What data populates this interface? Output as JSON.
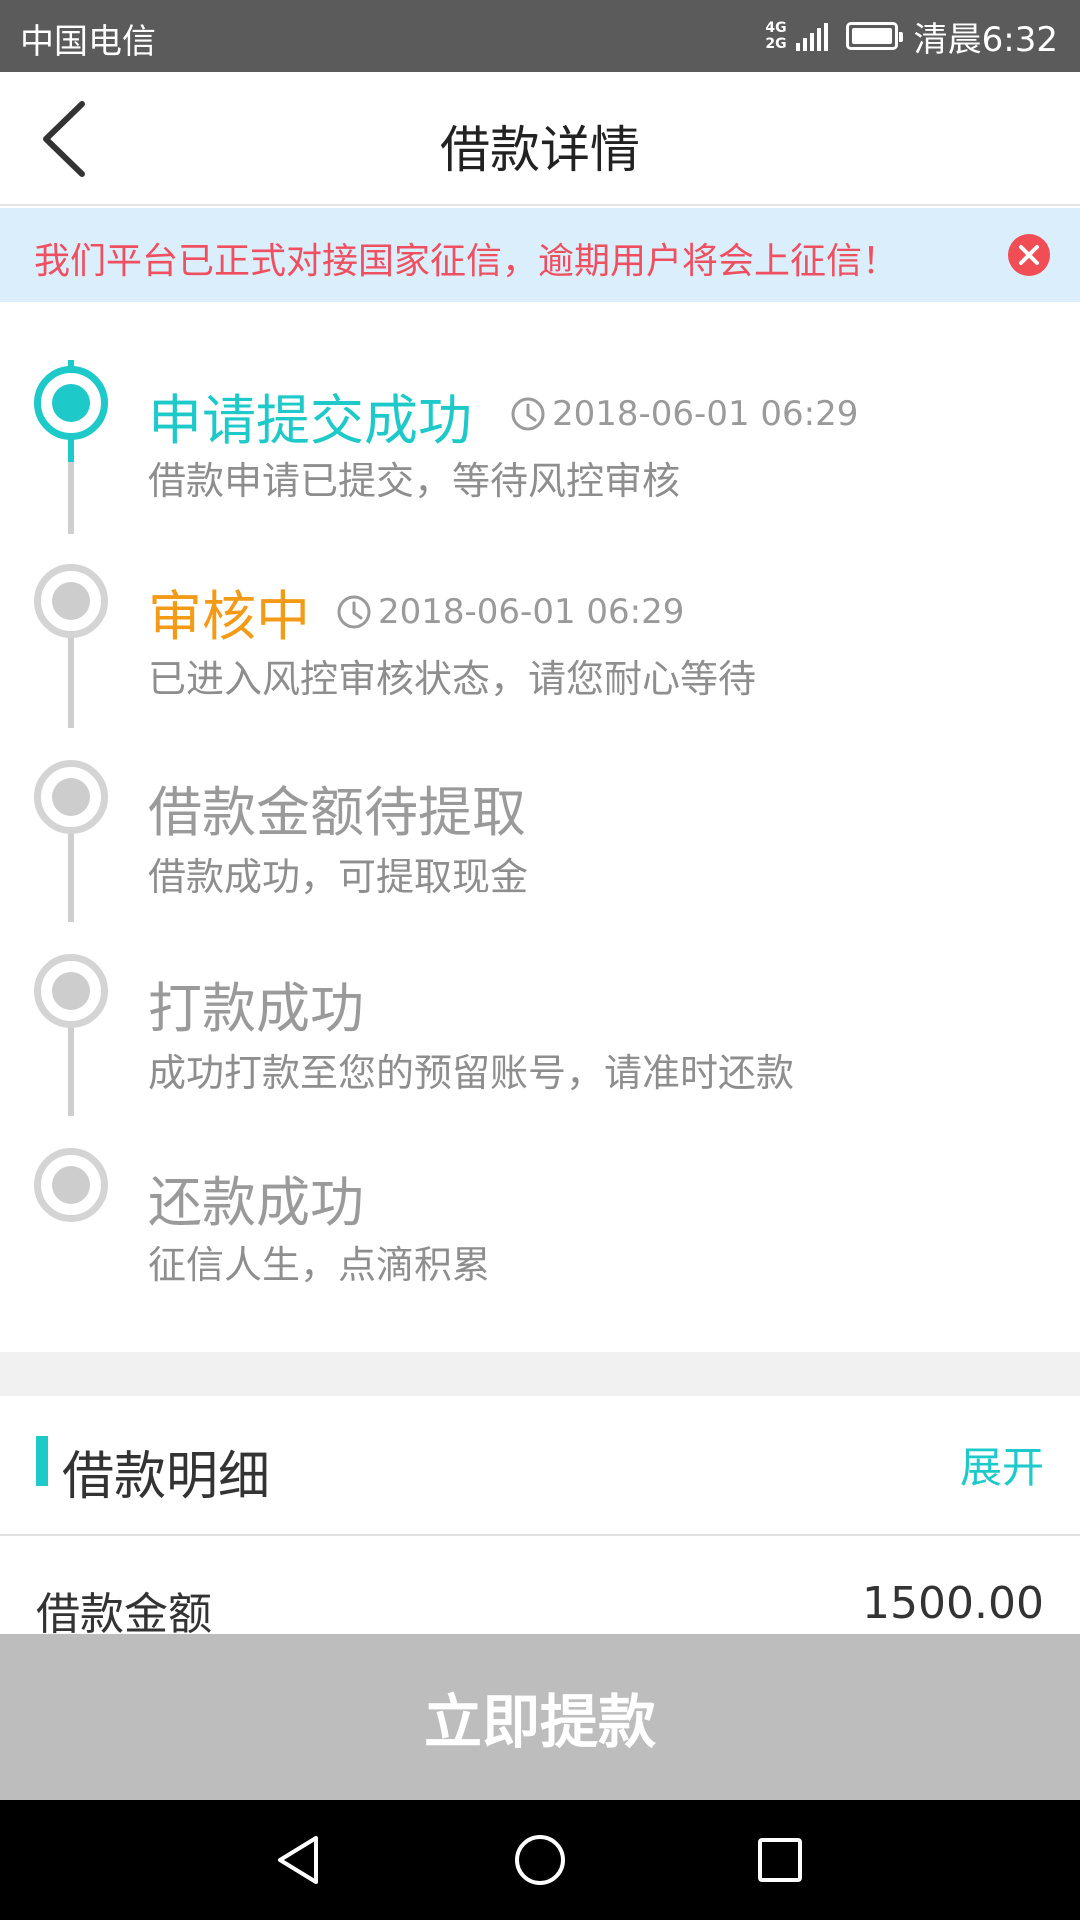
{
  "status_bar": {
    "carrier": "中国电信",
    "network_top": "4G",
    "network_bottom": "2G",
    "time": "清晨6:32"
  },
  "header": {
    "title": "借款详情"
  },
  "notice": {
    "text": "我们平台已正式对接国家征信，逾期用户将会上征信！"
  },
  "timeline": {
    "steps": [
      {
        "title": "申请提交成功",
        "time": "2018-06-01 06:29",
        "desc": "借款申请已提交，等待风控审核"
      },
      {
        "title": "审核中",
        "time": "2018-06-01 06:29",
        "desc": "已进入风控审核状态，请您耐心等待"
      },
      {
        "title": "借款金额待提取",
        "time": "",
        "desc": "借款成功，可提取现金"
      },
      {
        "title": "打款成功",
        "time": "",
        "desc": "成功打款至您的预留账号，请准时还款"
      },
      {
        "title": "还款成功",
        "time": "",
        "desc": "征信人生，点滴积累"
      }
    ]
  },
  "detail": {
    "title": "借款明细",
    "expand_label": "展开",
    "rows": [
      {
        "label": "借款金额",
        "value": "1500.00"
      }
    ]
  },
  "action": {
    "withdraw_label": "立即提款"
  },
  "colors": {
    "accent": "#1ec9c9",
    "review": "#f39a16",
    "notice_text": "#ef4f5f",
    "notice_bg": "#dbeefb",
    "button_disabled": "#bdbdbd"
  }
}
